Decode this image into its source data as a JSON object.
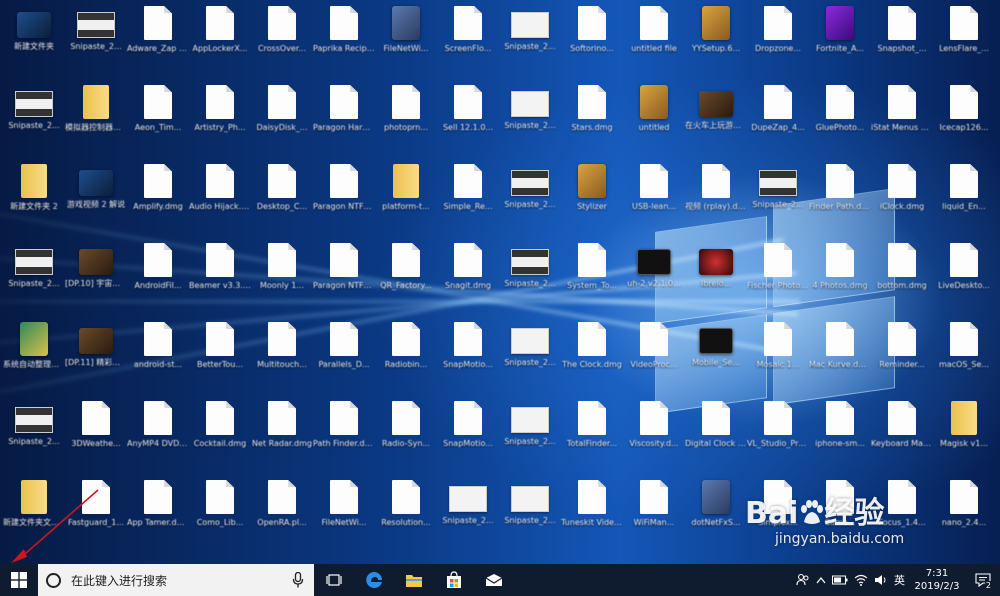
{
  "desktop": {
    "icons": [
      {
        "label": "新建文件夹",
        "type": "app-blue"
      },
      {
        "label": "Snipaste_2...",
        "type": "shot-dark"
      },
      {
        "label": "Adware_Zap Cleaner_2...",
        "type": "doc"
      },
      {
        "label": "AppLockerX...",
        "type": "doc"
      },
      {
        "label": "CrossOver...",
        "type": "doc"
      },
      {
        "label": "Paprika Recipe Ma...",
        "type": "doc"
      },
      {
        "label": "FileNetWi...",
        "type": "app-tool"
      },
      {
        "label": "ScreenFlo...",
        "type": "doc"
      },
      {
        "label": "Snipaste_2...",
        "type": "shot"
      },
      {
        "label": "Softorino...",
        "type": "doc"
      },
      {
        "label": "untitled file",
        "type": "doc"
      },
      {
        "label": "YYSetup.6...",
        "type": "app-box"
      },
      {
        "label": "Dropzone...",
        "type": "doc"
      },
      {
        "label": "Fortnite_A...",
        "type": "app-purple"
      },
      {
        "label": "Snapshot_...",
        "type": "doc"
      },
      {
        "label": "LensFlare_...",
        "type": "doc"
      },
      {
        "label": "Snipaste_2...",
        "type": "shot-dark"
      },
      {
        "label": "模拟器控制器软件",
        "type": "folderv"
      },
      {
        "label": "Aeon_Tim...",
        "type": "doc"
      },
      {
        "label": "Artistry_Ph...",
        "type": "doc"
      },
      {
        "label": "DaisyDisk_...",
        "type": "doc"
      },
      {
        "label": "Paragon Hard Disk...",
        "type": "doc"
      },
      {
        "label": "photoprn...",
        "type": "doc"
      },
      {
        "label": "Sell 12.1.0...",
        "type": "doc"
      },
      {
        "label": "Snipaste_2...",
        "type": "shot"
      },
      {
        "label": "Stars.dmg",
        "type": "doc"
      },
      {
        "label": "untitled",
        "type": "app-box"
      },
      {
        "label": "在火车上玩游戏.mp4",
        "type": "app-photo"
      },
      {
        "label": "DupeZap_4...",
        "type": "doc"
      },
      {
        "label": "GluePhoto...",
        "type": "doc"
      },
      {
        "label": "iStat Menus 6.1.0...",
        "type": "doc"
      },
      {
        "label": "Icecap126...",
        "type": "doc"
      },
      {
        "label": "新建文件夹 2",
        "type": "folderv"
      },
      {
        "label": "游戏视频 2 解说",
        "type": "app-blue"
      },
      {
        "label": "Amplify.dmg",
        "type": "doc"
      },
      {
        "label": "Audio Hijack.dmg",
        "type": "doc"
      },
      {
        "label": "Desktop_C...",
        "type": "doc"
      },
      {
        "label": "Paragon NTFS.dmg",
        "type": "doc"
      },
      {
        "label": "platform-t...",
        "type": "folderv"
      },
      {
        "label": "Simple_Re...",
        "type": "doc"
      },
      {
        "label": "Snipaste_2...",
        "type": "shot-dark"
      },
      {
        "label": "Stylizer",
        "type": "app-box"
      },
      {
        "label": "USB-lean...",
        "type": "doc"
      },
      {
        "label": "视频 (rplay).dmg",
        "type": "doc"
      },
      {
        "label": "Snipaste_2...",
        "type": "shot-dark"
      },
      {
        "label": "Finder Path.dmg",
        "type": "doc"
      },
      {
        "label": "iClock.dmg",
        "type": "doc"
      },
      {
        "label": "liquid_En...",
        "type": "doc"
      },
      {
        "label": "Snipaste_2...",
        "type": "shot-dark"
      },
      {
        "label": "[DP.10] 宇宙冒险系列",
        "type": "app-photo"
      },
      {
        "label": "AndroidFil...",
        "type": "doc"
      },
      {
        "label": "Beamer v3.3.3 mac...",
        "type": "doc"
      },
      {
        "label": "Moonly 1...",
        "type": "doc"
      },
      {
        "label": "Paragon NTFS 1.dmg",
        "type": "doc"
      },
      {
        "label": "QR_Factory...",
        "type": "doc"
      },
      {
        "label": "Snagit.dmg",
        "type": "doc"
      },
      {
        "label": "Snipaste_2...",
        "type": "shot-dark"
      },
      {
        "label": "System_To...",
        "type": "doc"
      },
      {
        "label": "uh-2 v2.1.0...",
        "type": "app-black"
      },
      {
        "label": "Ibrelo...",
        "type": "app-red"
      },
      {
        "label": "Fischer Photo.dmg",
        "type": "doc"
      },
      {
        "label": "4 Photos.dmg",
        "type": "doc"
      },
      {
        "label": "bottom.dmg",
        "type": "doc"
      },
      {
        "label": "LiveDeskto...",
        "type": "doc"
      },
      {
        "label": "系统自动整理文件夹",
        "type": "app-green"
      },
      {
        "label": "[DP.11] 精彩游戏视频",
        "type": "app-photo"
      },
      {
        "label": "android-st...",
        "type": "doc"
      },
      {
        "label": "BetterTou...",
        "type": "doc"
      },
      {
        "label": "Multitouch...",
        "type": "doc"
      },
      {
        "label": "Parallels_D...",
        "type": "doc"
      },
      {
        "label": "Radiobin...",
        "type": "doc"
      },
      {
        "label": "SnapMotio...",
        "type": "doc"
      },
      {
        "label": "Snipaste_2...",
        "type": "shot"
      },
      {
        "label": "The Clock.dmg",
        "type": "doc"
      },
      {
        "label": "VideoProc...",
        "type": "doc"
      },
      {
        "label": "Mobile_Se...",
        "type": "app-black"
      },
      {
        "label": "Mosaic 1...",
        "type": "doc"
      },
      {
        "label": "Mac Kurve.dmg",
        "type": "doc"
      },
      {
        "label": "Reminder...",
        "type": "doc"
      },
      {
        "label": "macOS_Se...",
        "type": "doc"
      },
      {
        "label": "Snipaste_2...",
        "type": "shot-dark"
      },
      {
        "label": "3DWeathe...",
        "type": "doc"
      },
      {
        "label": "AnyMP4 DVD Rapp...",
        "type": "doc"
      },
      {
        "label": "Cocktail.dmg",
        "type": "doc"
      },
      {
        "label": "Net Radar.dmg",
        "type": "doc"
      },
      {
        "label": "Path Finder.dmg",
        "type": "doc"
      },
      {
        "label": "Radio-Syn...",
        "type": "doc"
      },
      {
        "label": "SnapMotio...",
        "type": "doc"
      },
      {
        "label": "Snipaste_2...",
        "type": "shot"
      },
      {
        "label": "TotalFinder...",
        "type": "doc"
      },
      {
        "label": "Viscosity.d...",
        "type": "doc"
      },
      {
        "label": "Digital Clock 3D.dmg",
        "type": "doc"
      },
      {
        "label": "VL_Studio_Pro.dmg",
        "type": "doc"
      },
      {
        "label": "iphone-sm...",
        "type": "doc"
      },
      {
        "label": "Keyboard Maestro 8...",
        "type": "doc"
      },
      {
        "label": "Magisk v1...",
        "type": "folderv"
      },
      {
        "label": "新建文件夹文件夹",
        "type": "folderv"
      },
      {
        "label": "Fastguard_1...",
        "type": "doc"
      },
      {
        "label": "App Tamer.dmg",
        "type": "doc"
      },
      {
        "label": "Como_Lib...",
        "type": "doc"
      },
      {
        "label": "OpenRA.pl...",
        "type": "doc"
      },
      {
        "label": "FileNetWi...",
        "type": "doc"
      },
      {
        "label": "Resolution...",
        "type": "doc"
      },
      {
        "label": "Snipaste_2...",
        "type": "shot"
      },
      {
        "label": "Snipaste_2...",
        "type": "shot"
      },
      {
        "label": "Tuneskit Video Co...",
        "type": "doc"
      },
      {
        "label": "WiFiMan...",
        "type": "doc"
      },
      {
        "label": "dotNetFxS...",
        "type": "app-tool"
      },
      {
        "label": "Simplex...",
        "type": "doc"
      },
      {
        "label": "Camo...",
        "type": "doc"
      },
      {
        "label": "Focus_1.4...",
        "type": "doc"
      },
      {
        "label": "nano_2.4...",
        "type": "doc"
      }
    ]
  },
  "watermark": {
    "brand_left": "Bai",
    "brand_right": "经验",
    "url": "jingyan.baidu.com"
  },
  "taskbar": {
    "search_placeholder": "在此键入进行搜索",
    "ime_label": "英",
    "clock_time": "7:31",
    "clock_date": "2019/2/3",
    "notification_count": "2",
    "icons": {
      "start": "windows-logo-icon",
      "search": "cortana-circle-icon",
      "mic": "microphone-icon",
      "task_view": "task-view-icon",
      "edge": "edge-icon",
      "explorer": "file-explorer-icon",
      "store": "store-icon",
      "mail": "mail-icon"
    },
    "colors": {
      "taskbar_bg": "#0f1c30",
      "search_bg": "#f2f2f2",
      "arrow": "#c81818"
    }
  }
}
